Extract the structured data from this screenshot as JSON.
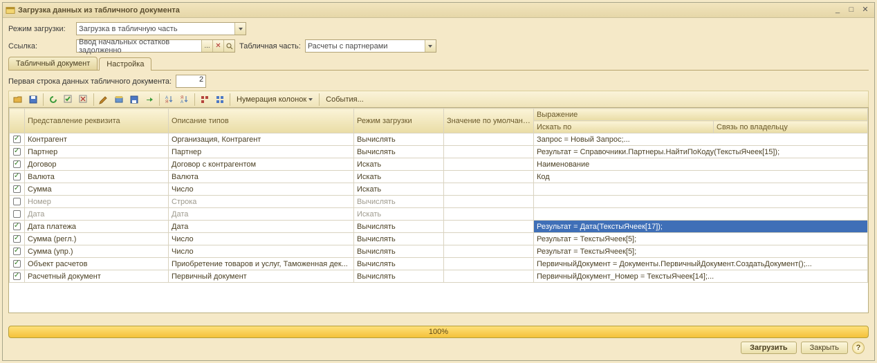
{
  "window": {
    "title": "Загрузка данных из табличного документа"
  },
  "form": {
    "mode_label": "Режим загрузки:",
    "mode_value": "Загрузка в табличную часть",
    "ref_label": "Ссылка:",
    "ref_value": "Ввод начальных остатков задолженно",
    "ref_ellipsis": "...",
    "tabpart_label": "Табличная часть:",
    "tabpart_value": "Расчеты с партнерами"
  },
  "tabs": {
    "doc": "Табличный документ",
    "settings": "Настройка"
  },
  "first_row": {
    "label": "Первая строка данных табличного документа:",
    "value": "2"
  },
  "toolbar": {
    "numbering": "Нумерация колонок",
    "events": "События..."
  },
  "columns": {
    "rep": "Представление реквизита",
    "types": "Описание типов",
    "mode": "Режим загрузки",
    "default": "Значение по умолчанию",
    "expr": "Выражение",
    "search": "Искать по",
    "owner": "Связь по владельцу"
  },
  "rows": [
    {
      "checked": true,
      "rep": "Контрагент",
      "types": "Организация, Контрагент",
      "mode": "Вычислять",
      "expr": "Запрос = Новый Запрос;..."
    },
    {
      "checked": true,
      "rep": "Партнер",
      "types": "Партнер",
      "mode": "Вычислять",
      "expr": "Результат =  Справочники.Партнеры.НайтиПоКоду(ТекстыЯчеек[15]);"
    },
    {
      "checked": true,
      "rep": "Договор",
      "types": "Договор с контрагентом",
      "mode": "Искать",
      "expr": "Наименование"
    },
    {
      "checked": true,
      "rep": "Валюта",
      "types": "Валюта",
      "mode": "Искать",
      "expr": "Код"
    },
    {
      "checked": true,
      "rep": "Сумма",
      "types": "Число",
      "mode": "Искать",
      "expr": ""
    },
    {
      "checked": false,
      "disabled": true,
      "rep": "Номер",
      "types": "Строка",
      "mode": "Вычислять",
      "expr": ""
    },
    {
      "checked": false,
      "disabled": true,
      "rep": "Дата",
      "types": "Дата",
      "mode": "Искать",
      "expr": ""
    },
    {
      "checked": true,
      "rep": "Дата платежа",
      "types": "Дата",
      "mode": "Вычислять",
      "expr": "Результат            = Дата(ТекстыЯчеек[17]);",
      "selected": true
    },
    {
      "checked": true,
      "rep": "Сумма (регл.)",
      "types": "Число",
      "mode": "Вычислять",
      "expr": "Результат =  ТекстыЯчеек[5];"
    },
    {
      "checked": true,
      "rep": "Сумма (упр.)",
      "types": "Число",
      "mode": "Вычислять",
      "expr": "Результат =  ТекстыЯчеек[5];"
    },
    {
      "checked": true,
      "rep": "Объект расчетов",
      "types": "Приобретение товаров и услуг, Таможенная дек...",
      "mode": "Вычислять",
      "expr": "ПервичныйДокумент = Документы.ПервичныйДокумент.СоздатьДокумент();..."
    },
    {
      "checked": true,
      "rep": "Расчетный документ",
      "types": "Первичный документ",
      "mode": "Вычислять",
      "expr": "ПервичныйДокумент_Номер = ТекстыЯчеек[14];..."
    }
  ],
  "progress": {
    "text": "100%"
  },
  "footer": {
    "run": "Загрузить",
    "close": "Закрыть"
  },
  "icon_colors": {
    "open": "#e5b347",
    "save": "#4d78c4",
    "refresh": "#3a9a3a",
    "checkall": "#3a9a3a",
    "uncheckall": "#b4443d",
    "edit": "#c78a2d",
    "restore": "#6a97cf",
    "save2": "#4d78c4",
    "arrow": "#3a9a3a",
    "sortaz": "#4573b4",
    "sortza": "#b4443d",
    "h1": "#b4443d",
    "h2": "#4d78c4"
  }
}
